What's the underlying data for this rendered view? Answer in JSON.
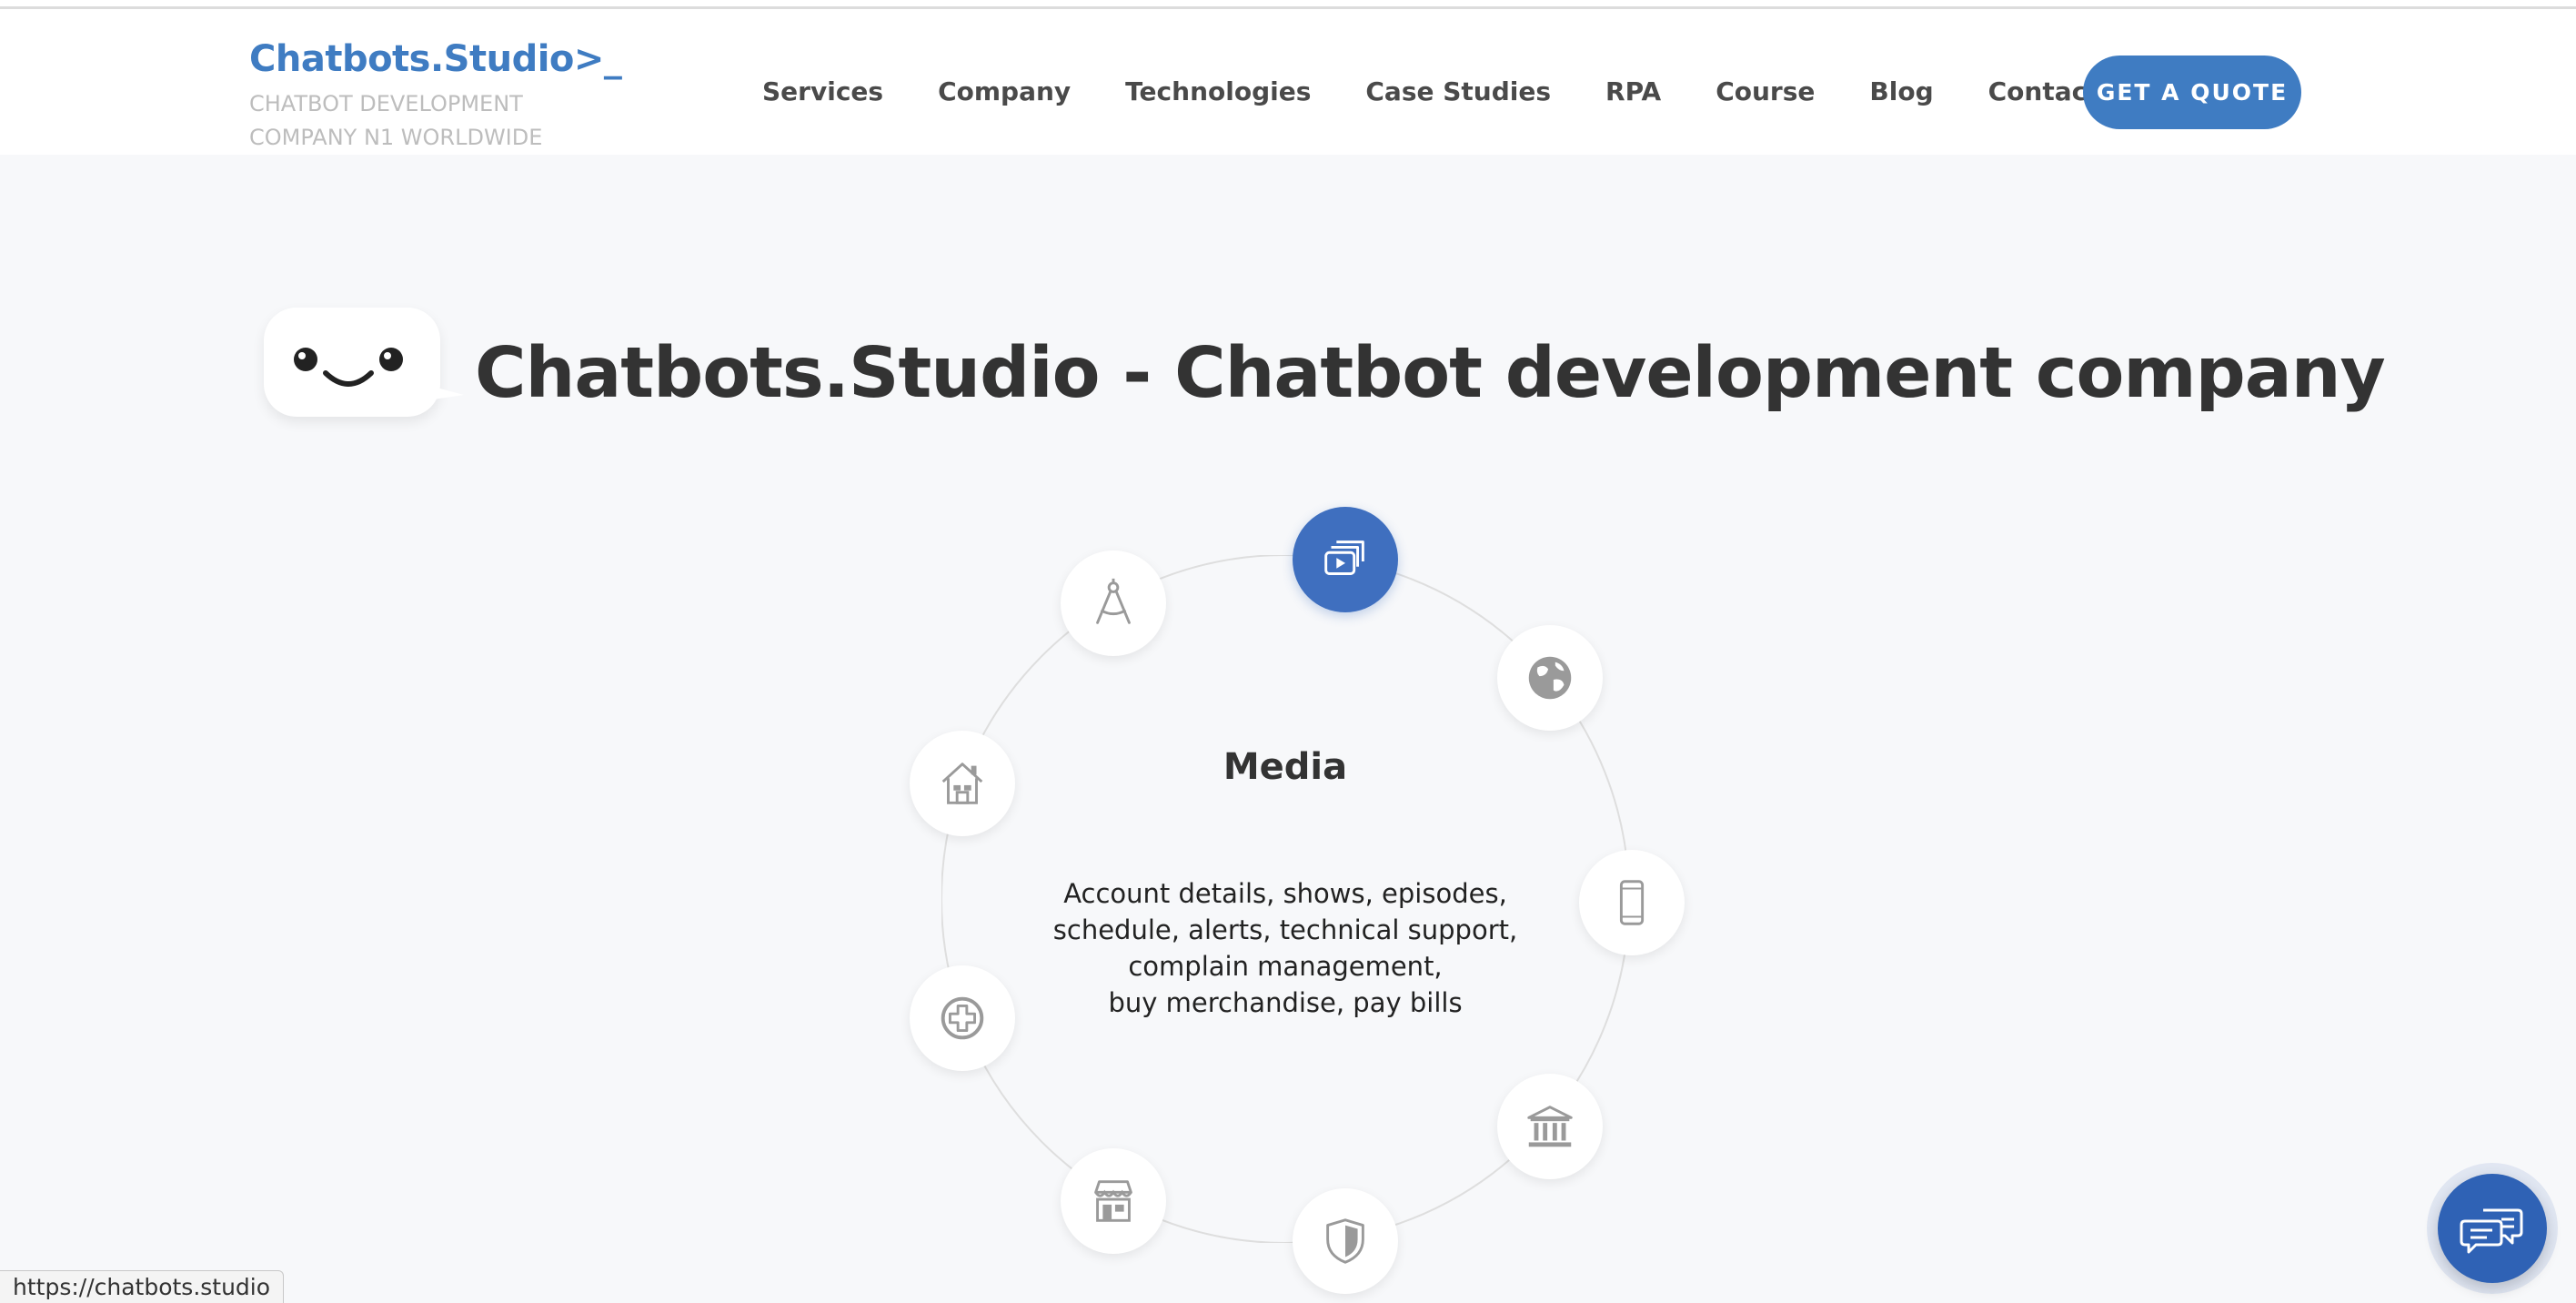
{
  "header": {
    "logo": "Chatbots.Studio>_",
    "tagline_line1": "CHATBOT DEVELOPMENT",
    "tagline_line2": "COMPANY N1 WORLDWIDE",
    "nav": [
      "Services",
      "Company",
      "Technologies",
      "Case Studies",
      "RPA",
      "Course",
      "Blog",
      "Contacts"
    ],
    "cta": "GET A QUOTE"
  },
  "hero": {
    "title": "Chatbots.Studio - Chatbot development company"
  },
  "industries": {
    "active": "Media",
    "active_description": "Account details, shows, episodes,\nschedule, alerts, technical support,\ncomplain management,\nbuy merchandise, pay bills",
    "icons": [
      "media-icon",
      "globe-icon",
      "smartphone-icon",
      "bank-icon",
      "shield-icon",
      "store-icon",
      "medical-icon",
      "real-estate-icon",
      "compass-icon"
    ]
  },
  "status_url": "https://chatbots.studio",
  "colors": {
    "brand": "#3f7cc2",
    "active_node": "#3f6fbf",
    "background": "#f7f8fa"
  }
}
